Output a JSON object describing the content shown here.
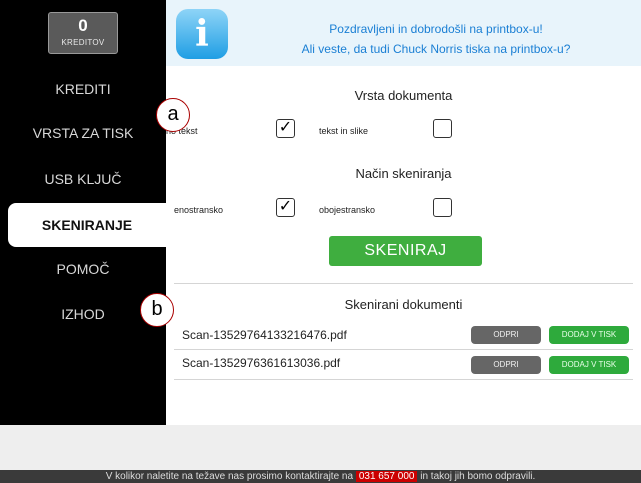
{
  "sidebar": {
    "credits": {
      "value": "0",
      "label": "KREDITOV"
    },
    "items": [
      {
        "label": "KREDITI"
      },
      {
        "label": "VRSTA ZA TISK"
      },
      {
        "label": "USB KLJUČ"
      },
      {
        "label": "SKENIRANJE",
        "active": true
      },
      {
        "label": "POMOČ"
      },
      {
        "label": "IZHOD"
      }
    ]
  },
  "header": {
    "line1": "Pozdravljeni in dobrodošli na printbox-u!",
    "line2": "Ali veste, da tudi Chuck Norris tiska na printbox-u?",
    "icon": "info-icon"
  },
  "doc_type": {
    "title": "Vrsta dokumenta",
    "options": [
      {
        "label": "no tekst",
        "checked": true
      },
      {
        "label": "tekst in slike",
        "checked": false
      }
    ]
  },
  "scan_mode": {
    "title": "Način skeniranja",
    "options": [
      {
        "label": "enostransko",
        "checked": true
      },
      {
        "label": "obojestransko",
        "checked": false
      }
    ]
  },
  "scan_button": "SKENIRAJ",
  "documents": {
    "title": "Skenirani dokumenti",
    "open_label": "ODPRI",
    "add_label": "DODAJ V TISK",
    "items": [
      "Scan-13529764133216476.pdf",
      "Scan-1352976361613036.pdf"
    ]
  },
  "footer": {
    "before": "V kolikor naletite na težave nas prosimo kontaktirajte na",
    "phone": "031 657 000",
    "after": "in takoj jih bomo odpravili."
  },
  "callouts": {
    "a": "a",
    "b": "b"
  },
  "colors": {
    "accent_green": "#3fae3f",
    "link_blue": "#1a7fd4",
    "sidebar_bg": "#000000"
  }
}
